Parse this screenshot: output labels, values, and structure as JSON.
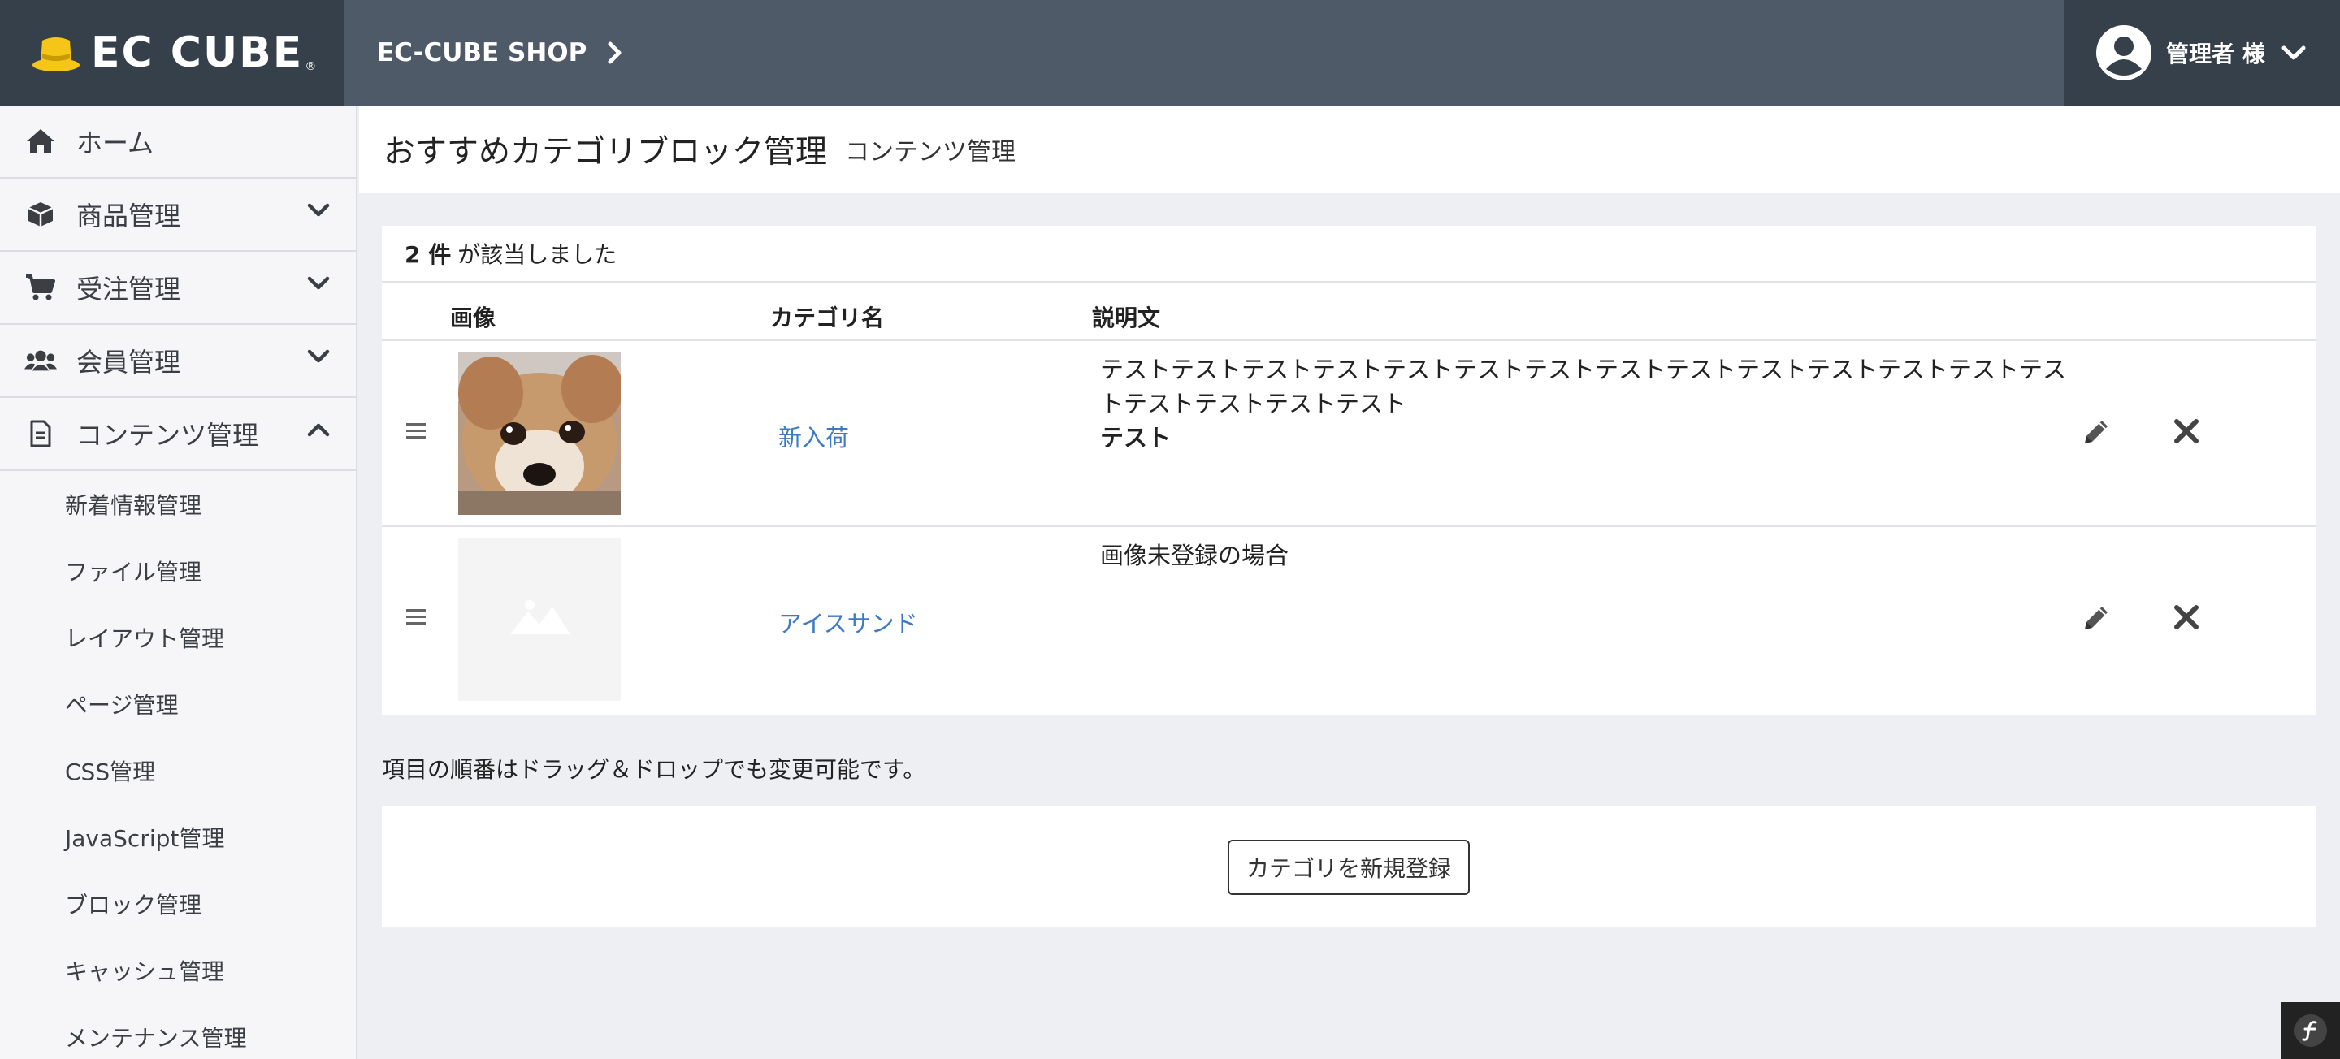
{
  "header": {
    "logo_text": "EC CUBE",
    "logo_reg": "®",
    "shop_name": "EC-CUBE SHOP",
    "user_name": "管理者 様"
  },
  "sidebar": {
    "items": [
      {
        "label": "ホーム",
        "icon": "home-icon"
      },
      {
        "label": "商品管理",
        "icon": "box-icon",
        "expandable": true
      },
      {
        "label": "受注管理",
        "icon": "cart-icon",
        "expandable": true
      },
      {
        "label": "会員管理",
        "icon": "users-icon",
        "expandable": true
      },
      {
        "label": "コンテンツ管理",
        "icon": "file-icon",
        "expanded": true
      }
    ],
    "sub_items": [
      "新着情報管理",
      "ファイル管理",
      "レイアウト管理",
      "ページ管理",
      "CSS管理",
      "JavaScript管理",
      "ブロック管理",
      "キャッシュ管理",
      "メンテナンス管理"
    ]
  },
  "page": {
    "title": "おすすめカテゴリブロック管理",
    "subtitle": "コンテンツ管理"
  },
  "table": {
    "count": "2 件",
    "count_suffix": "が該当しました",
    "headers": {
      "image": "画像",
      "category": "カテゴリ名",
      "description": "説明文"
    },
    "rows": [
      {
        "image": "dog-photo",
        "category": "新入荷",
        "description": "テストテストテストテストテストテストテストテストテストテストテストテストテストテストテストテストテストテスト",
        "description_bold": "テスト"
      },
      {
        "image": "no-image-placeholder",
        "category": "アイスサンド",
        "description": "画像未登録の場合",
        "description_bold": ""
      }
    ]
  },
  "note": "項目の順番はドラッグ＆ドロップでも変更可能です。",
  "new_button": "カテゴリを新規登録",
  "colors": {
    "header_bg": "#4e5a68",
    "header_dark": "#36404a",
    "link": "#3d7ac4",
    "page_bg": "#eeeff3",
    "logo_yellow": "#f5c518"
  }
}
